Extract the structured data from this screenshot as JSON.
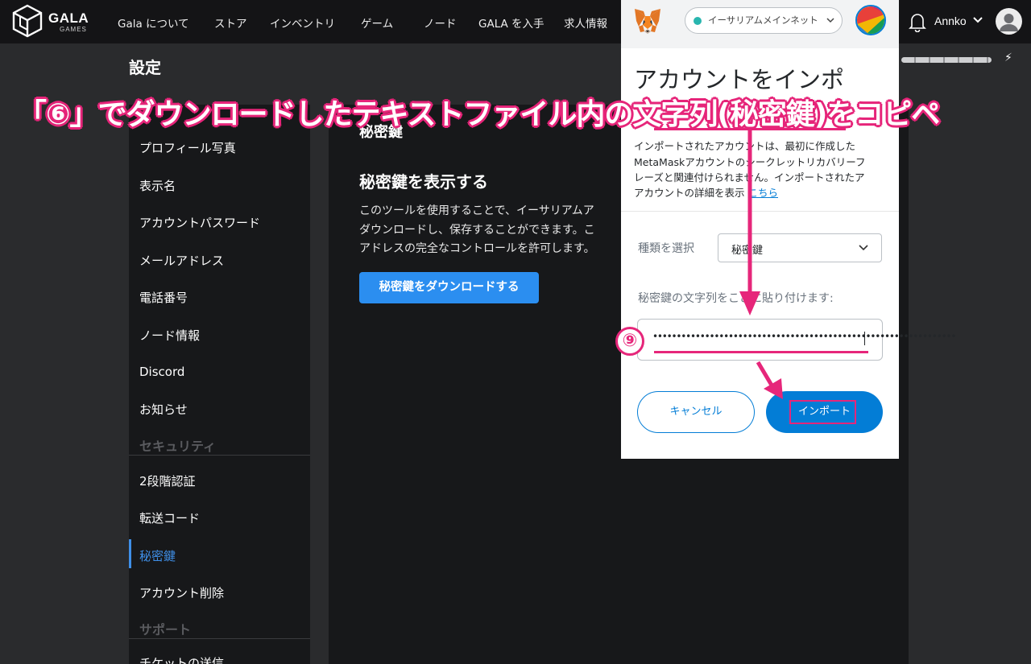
{
  "nav": {
    "logo_text": "GALA",
    "logo_sub": "GAMES",
    "items": [
      "Gala について",
      "ストア",
      "インベントリ",
      "ゲーム",
      "ノード",
      "GALA を入手",
      "求人情報"
    ],
    "username": "Annko"
  },
  "page": {
    "title": "設定"
  },
  "sidebar": {
    "items": [
      "プロフィール写真",
      "表示名",
      "アカウントパスワード",
      "メールアドレス",
      "電話番号",
      "ノード情報",
      "Discord",
      "お知らせ"
    ],
    "section_security": "セキュリティ",
    "security_items": [
      "2段階認証",
      "転送コード",
      "秘密鍵",
      "アカウント削除"
    ],
    "active_item": "秘密鍵",
    "section_support": "サポート",
    "support_items": [
      "チケットの送信"
    ]
  },
  "main": {
    "heading": "秘密鍵",
    "subheading": "秘密鍵を表示する",
    "paragraph_lines": [
      "このツールを使用することで、イーサリアムア",
      "ダウンロードし、保存することができます。こ",
      "アドレスの完全なコントロールを許可します。"
    ],
    "download_button": "秘密鍵をダウンロードする"
  },
  "metamask": {
    "network": "イーサリアムメインネット",
    "network_color": "#29b6af",
    "title": "アカウントをインポ",
    "description_lines": [
      "インポートされたアカウントは、最初に作成した",
      "MetaMaskアカウントのシークレットリカバリーフ",
      "レーズと関連付けられません。インポートされたア",
      "アカウントの詳細を表示 "
    ],
    "link_text": "こちら",
    "select_label": "種類を選択",
    "select_value": "秘密鍵",
    "paste_label": "秘密鍵の文字列をここに貼り付けます:",
    "key_value": "••••••••••••••••••••••••••••••••••••••••••••••••••••••••••••••••",
    "cancel_button": "キャンセル",
    "import_button": "インポート",
    "accent_color": "#037dd6"
  },
  "annotation": {
    "banner": "「⑥」でダウンロードしたテキストファイル内の文字列(秘密鍵)をコピペ",
    "step_number": "⑨",
    "color": "#e6267a"
  }
}
